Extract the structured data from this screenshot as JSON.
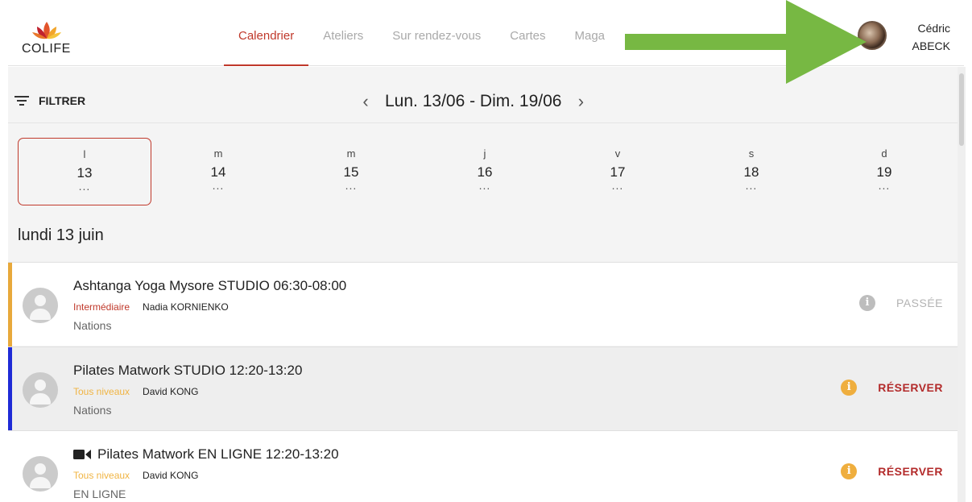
{
  "header": {
    "logo_text": "COLIFE",
    "nav": [
      {
        "label": "Calendrier",
        "active": true
      },
      {
        "label": "Ateliers",
        "active": false
      },
      {
        "label": "Sur rendez-vous",
        "active": false
      },
      {
        "label": "Cartes",
        "active": false
      },
      {
        "label": "Maga",
        "active": false
      }
    ],
    "user": {
      "first_name": "Cédric",
      "last_name": "ABECK"
    }
  },
  "toolbar": {
    "filter_label": "FILTRER",
    "prev_icon": "chevron-left-icon",
    "next_icon": "chevron-right-icon",
    "week_label": "Lun. 13/06 - Dim. 19/06"
  },
  "days": [
    {
      "letter": "l",
      "num": "13",
      "dots": "...",
      "selected": true
    },
    {
      "letter": "m",
      "num": "14",
      "dots": "...",
      "selected": false
    },
    {
      "letter": "m",
      "num": "15",
      "dots": "...",
      "selected": false
    },
    {
      "letter": "j",
      "num": "16",
      "dots": "...",
      "selected": false
    },
    {
      "letter": "v",
      "num": "17",
      "dots": "...",
      "selected": false
    },
    {
      "letter": "s",
      "num": "18",
      "dots": "...",
      "selected": false
    },
    {
      "letter": "d",
      "num": "19",
      "dots": "...",
      "selected": false
    }
  ],
  "date_heading": "lundi 13 juin",
  "sessions": [
    {
      "title": "Ashtanga Yoga Mysore STUDIO 06:30-08:00",
      "online": false,
      "level": "Intermédiaire",
      "level_color": "#c0392b",
      "teacher": "Nadia KORNIENKO",
      "location": "Nations",
      "bar_color": "#e8a93b",
      "info_color": "#bdbdbd",
      "status": "PASSÉE",
      "status_kind": "past"
    },
    {
      "title": "Pilates Matwork STUDIO 12:20-13:20",
      "online": false,
      "level": "Tous niveaux",
      "level_color": "#f0b443",
      "teacher": "David KONG",
      "location": "Nations",
      "bar_color": "#1f2bd6",
      "info_color": "#efae3e",
      "status": "RÉSERVER",
      "status_kind": "book"
    },
    {
      "title": "Pilates Matwork EN LIGNE 12:20-13:20",
      "online": true,
      "level": "Tous niveaux",
      "level_color": "#f0b443",
      "teacher": "David KONG",
      "location": "EN LIGNE",
      "bar_color": "",
      "info_color": "#efae3e",
      "status": "RÉSERVER",
      "status_kind": "book"
    }
  ],
  "colors": {
    "accent": "#c0392b",
    "arrow": "#77b843"
  }
}
